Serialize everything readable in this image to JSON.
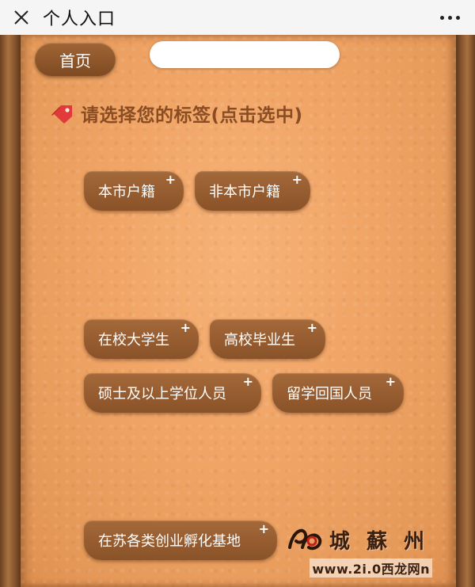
{
  "nav": {
    "title": "个人入口",
    "close_icon": "close-icon",
    "more_icon": "more-dots-icon"
  },
  "toolbar": {
    "home_label": "首页",
    "search_placeholder": ""
  },
  "heading": {
    "icon": "tag-icon",
    "text": "请选择您的标签(点击选中)"
  },
  "tags": [
    {
      "label": "本市户籍",
      "plus": "+"
    },
    {
      "label": "非本市户籍",
      "plus": "+"
    },
    {
      "label": "在校大学生",
      "plus": "+"
    },
    {
      "label": "高校毕业生",
      "plus": "+"
    },
    {
      "label": "硕士及以上学位人员",
      "plus": "+"
    },
    {
      "label": "留学回国人员",
      "plus": "+"
    },
    {
      "label": "在苏各类创业孵化基地",
      "plus": "+"
    }
  ],
  "watermark": {
    "brand": "城 蘇 州",
    "url": "www.2i.0西龙网n"
  },
  "colors": {
    "leather": "#f0a465",
    "chip": "#8a5228",
    "heading": "#8a4d23",
    "tag_icon": "#e03a3a"
  }
}
